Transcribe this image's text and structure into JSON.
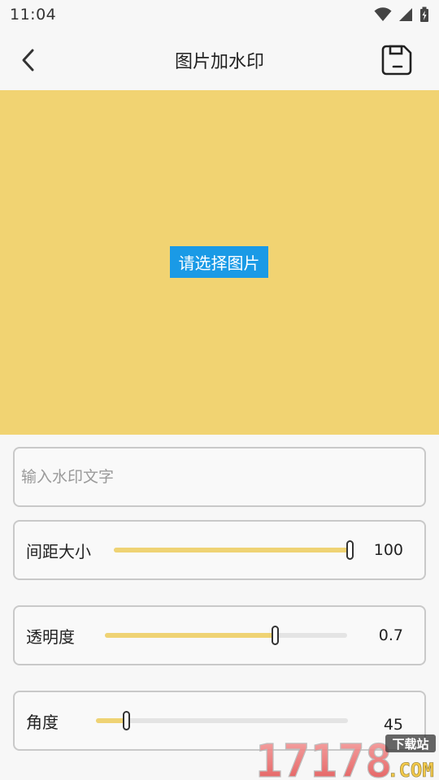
{
  "status_bar": {
    "time": "11:04"
  },
  "app_bar": {
    "title": "图片加水印",
    "back_icon": "chevron-left-icon",
    "save_icon": "floppy-disk-icon"
  },
  "preview": {
    "background_color": "#f1d372",
    "pick_button_label": "请选择图片",
    "pick_button_color": "#1a9ae6"
  },
  "watermark_text": {
    "placeholder": "输入水印文字",
    "value": ""
  },
  "controls": {
    "spacing": {
      "label": "间距大小",
      "value": "100",
      "fraction": 1.0
    },
    "opacity": {
      "label": "透明度",
      "value": "0.7",
      "fraction": 0.7
    },
    "angle": {
      "label": "角度",
      "value": "45",
      "fraction": 0.12
    }
  },
  "colors": {
    "slider_fill": "#efd374",
    "slider_track": "#e4e4e4"
  },
  "watermark_logo": {
    "number": "17178",
    "domain": ".COM",
    "badge": "下载站"
  }
}
